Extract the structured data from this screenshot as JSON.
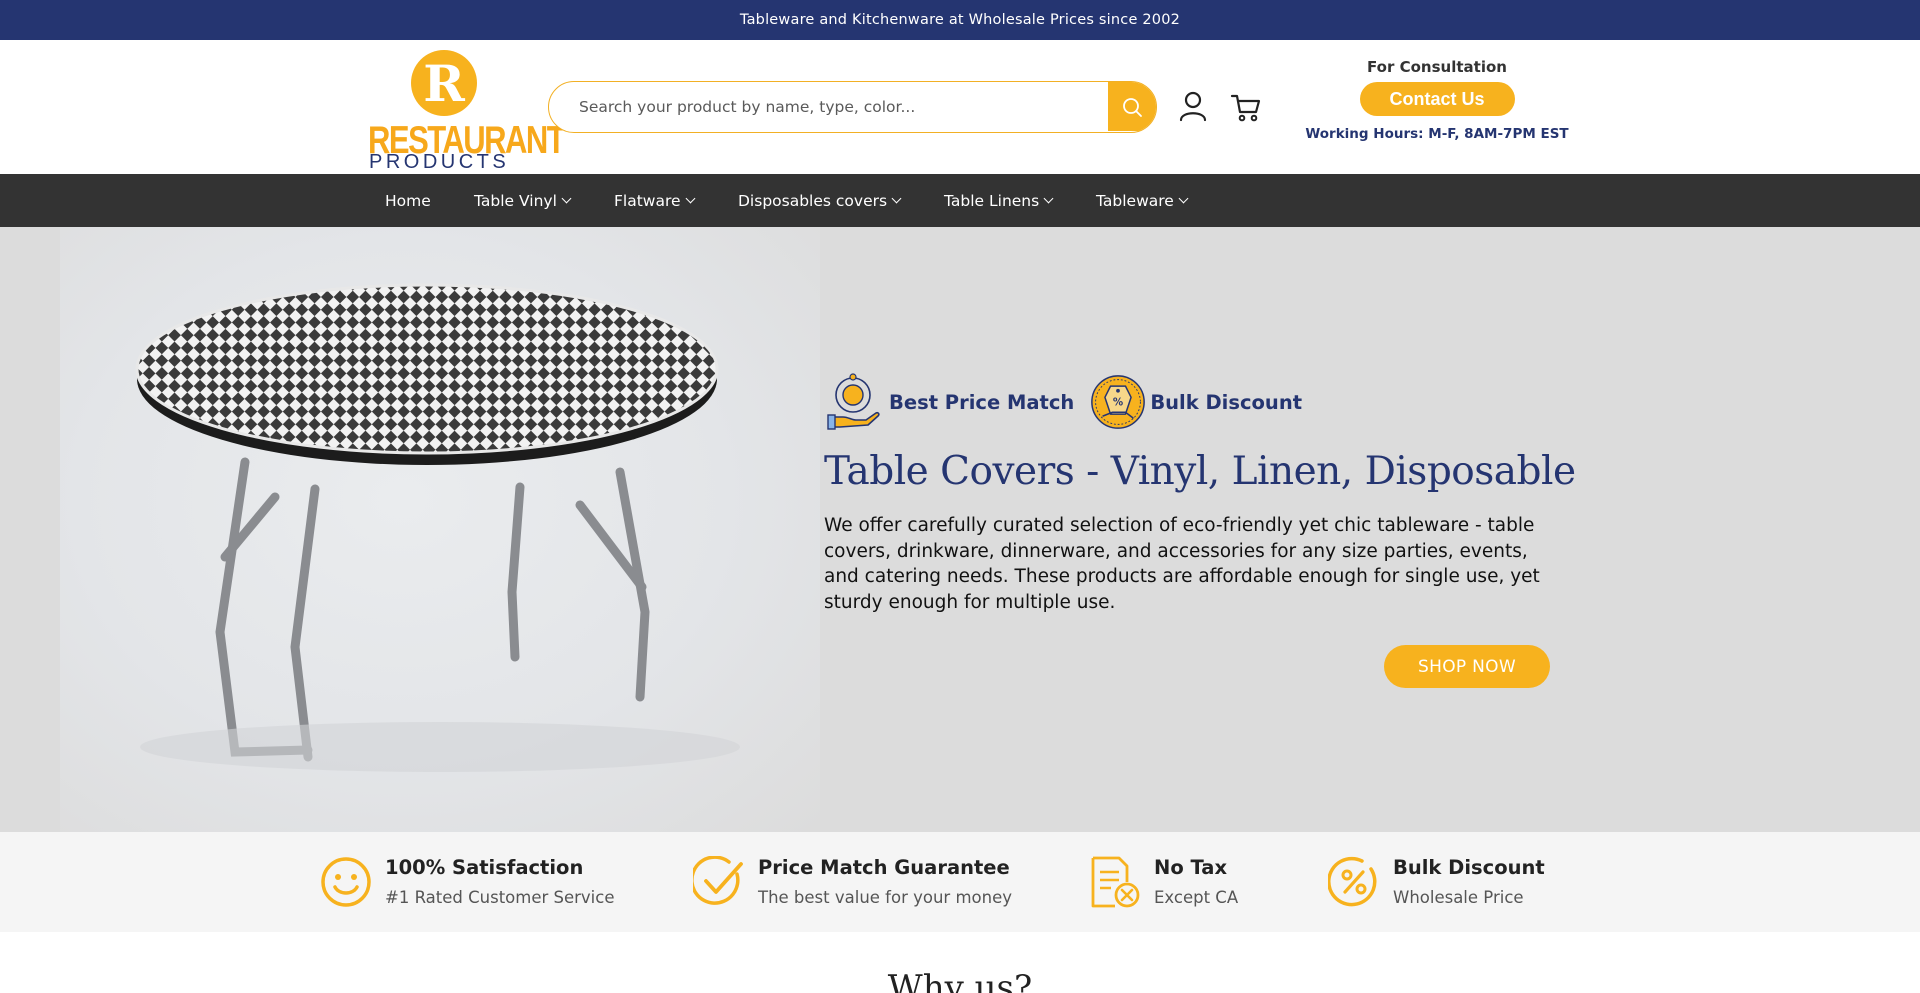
{
  "announcement": "Tableware and Kitchenware at Wholesale Prices since 2002",
  "logo": {
    "line1": "RESTAURANT",
    "line2": "PRODUCTS",
    "mark_letter": "R"
  },
  "search": {
    "placeholder": "Search your product by name, type, color...",
    "icon": "search-icon"
  },
  "header_icons": {
    "account": "account-icon",
    "cart": "cart-icon"
  },
  "consultation": {
    "label": "For Consultation",
    "button": "Contact Us",
    "hours": "Working Hours: M-F, 8AM-7PM EST"
  },
  "nav": [
    {
      "label": "Home",
      "dropdown": false
    },
    {
      "label": "Table Vinyl",
      "dropdown": true
    },
    {
      "label": "Flatware",
      "dropdown": true
    },
    {
      "label": "Disposables covers",
      "dropdown": true
    },
    {
      "label": "Table Linens",
      "dropdown": true
    },
    {
      "label": "Tableware",
      "dropdown": true
    }
  ],
  "hero": {
    "badges": [
      {
        "label": "Best Price Match",
        "icon": "price-match-icon"
      },
      {
        "label": "Bulk Discount",
        "icon": "bulk-discount-tag-icon"
      }
    ],
    "title": "Table Covers - Vinyl, Linen, Disposable",
    "description": "We offer carefully curated selection of eco-friendly yet chic tableware - table covers, drinkware, dinnerware, and accessories for any size parties, events, and catering needs. These products are affordable enough for single use, yet sturdy enough for multiple use.",
    "cta": "SHOP NOW",
    "image": "round-table-checkered-cover"
  },
  "features": [
    {
      "title": "100% Satisfaction",
      "subtitle": "#1 Rated Customer Service",
      "icon": "smiley-icon"
    },
    {
      "title": "Price Match Guarantee",
      "subtitle": "The best value for your money",
      "icon": "checkmark-icon"
    },
    {
      "title": "No Tax",
      "subtitle": "Except CA",
      "icon": "no-tax-document-icon"
    },
    {
      "title": "Bulk Discount",
      "subtitle": "Wholesale Price",
      "icon": "percent-icon"
    }
  ],
  "section_heading": "Why us?",
  "colors": {
    "navy": "#253571",
    "accent": "#f7b21e",
    "nav_bg": "#333333",
    "hero_bg": "#dcdcdc"
  }
}
